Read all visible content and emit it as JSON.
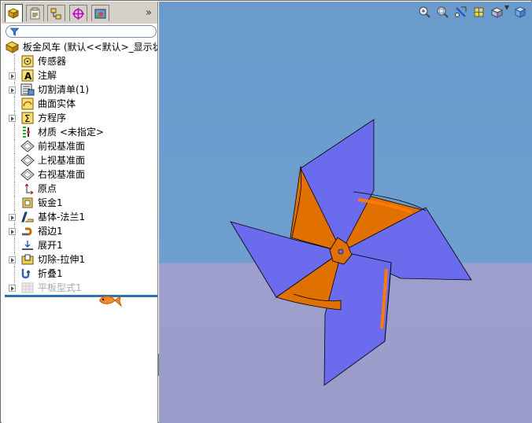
{
  "feature_tree": {
    "root_label": "板金风车 (默认<<默认>_显示状",
    "items": [
      {
        "label": "传感器",
        "icon": "sensor-icon",
        "expandable": false
      },
      {
        "label": "注解",
        "icon": "annotation-icon",
        "expandable": true
      },
      {
        "label": "切割清单(1)",
        "icon": "cut-list-icon",
        "expandable": true
      },
      {
        "label": "曲面实体",
        "icon": "surface-bodies-icon",
        "expandable": false
      },
      {
        "label": "方程序",
        "icon": "equations-icon",
        "expandable": true
      },
      {
        "label": "材质 <未指定>",
        "icon": "material-icon",
        "expandable": false
      },
      {
        "label": "前视基准面",
        "icon": "plane-icon",
        "expandable": false
      },
      {
        "label": "上视基准面",
        "icon": "plane-icon",
        "expandable": false
      },
      {
        "label": "右视基准面",
        "icon": "plane-icon",
        "expandable": false
      },
      {
        "label": "原点",
        "icon": "origin-icon",
        "expandable": false
      },
      {
        "label": "钣金1",
        "icon": "sheet-metal-icon",
        "expandable": false
      },
      {
        "label": "基体-法兰1",
        "icon": "base-flange-icon",
        "expandable": true
      },
      {
        "label": "褶边1",
        "icon": "hem-icon",
        "expandable": true
      },
      {
        "label": "展开1",
        "icon": "unfold-icon",
        "expandable": false
      },
      {
        "label": "切除-拉伸1",
        "icon": "cut-extrude-icon",
        "expandable": true
      },
      {
        "label": "折叠1",
        "icon": "fold-icon",
        "expandable": false
      },
      {
        "label": "平板型式1",
        "icon": "flat-pattern-icon",
        "expandable": true,
        "suppressed": true
      }
    ]
  },
  "tabs": [
    "feature-manager-icon",
    "property-manager-icon",
    "configuration-manager-icon",
    "dimxpert-icon",
    "display-manager-icon"
  ],
  "tab_more_label": "»",
  "view_toolbar": [
    "zoom-to-fit-icon",
    "zoom-area-icon",
    "section-view-icon",
    "view-orientation-icon",
    "display-style-icon",
    "view-cube-icon"
  ],
  "colors": {
    "viewport_sky": "#6b9bcc",
    "viewport_floor": "#9f9fcf",
    "blade_blue": "#6b6bee",
    "blade_orange": "#e07000",
    "rollback_bar": "#2f6fb0"
  }
}
